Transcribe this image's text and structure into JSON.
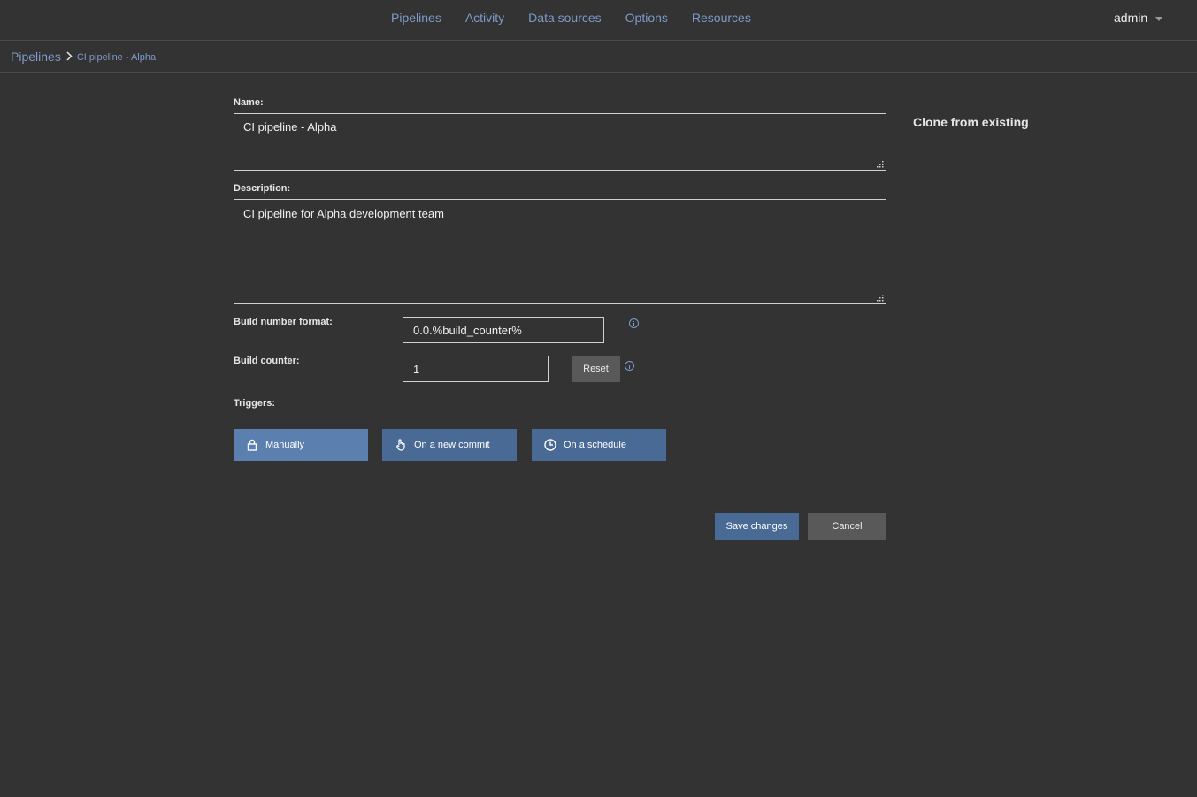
{
  "nav": {
    "items": [
      "Pipelines",
      "Activity",
      "Data sources",
      "Options",
      "Resources"
    ],
    "user": "admin"
  },
  "breadcrumb": {
    "root": "Pipelines",
    "current": "CI pipeline - Alpha"
  },
  "form": {
    "name_label": "Name:",
    "name_value": "CI pipeline - Alpha",
    "description_label": "Description:",
    "description_value": "CI pipeline for Alpha development team",
    "build_format_label": "Build number format:",
    "build_format_value": "0.0.%build_counter%",
    "build_counter_label": "Build counter:",
    "build_counter_value": "1",
    "reset_label": "Reset",
    "triggers_label": "Triggers:",
    "triggers": [
      {
        "label": "Manually",
        "icon": "lock-icon",
        "color": "#5b80b0"
      },
      {
        "label": "On a new commit",
        "icon": "hand-icon",
        "color": "#4a6a96"
      },
      {
        "label": "On a schedule",
        "icon": "clock-icon",
        "color": "#4a6a96"
      }
    ],
    "save_label": "Save changes",
    "cancel_label": "Cancel"
  },
  "side": {
    "clone_label": "Clone from existing"
  },
  "colors": {
    "background": "#333333",
    "link": "#7d9bc8",
    "primary": "#4a6a96",
    "trigger_active": "#5b80b0",
    "grey_button": "#595959"
  }
}
